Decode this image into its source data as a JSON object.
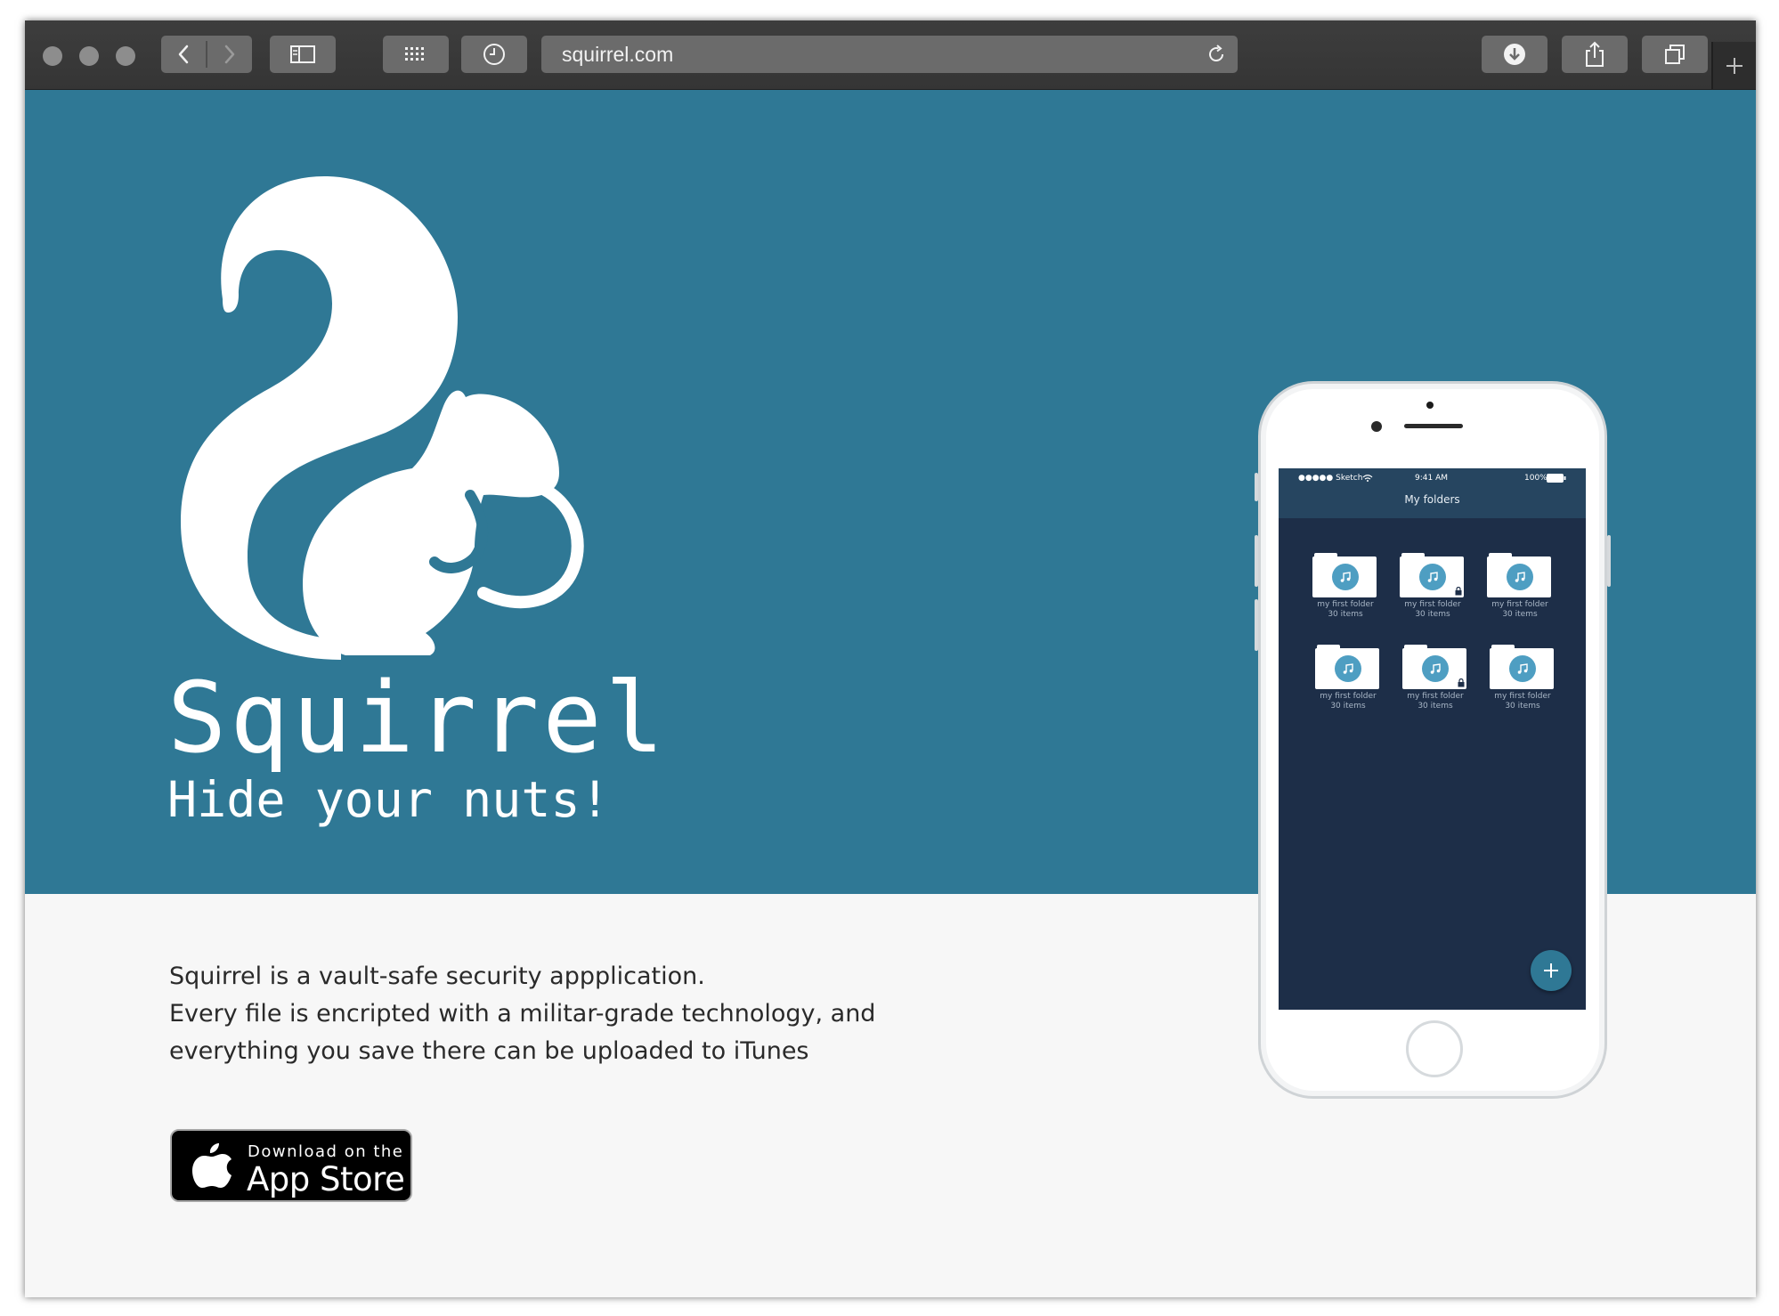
{
  "browser": {
    "url": "squirrel.com",
    "colors": {
      "toolbar": "#3a3a3a",
      "button": "#6b6b6b"
    },
    "icons": [
      "close-dot",
      "minimize-dot",
      "zoom-dot",
      "back-icon",
      "forward-icon",
      "sidebar-icon",
      "grid-icon",
      "history-clock-icon",
      "reload-icon",
      "download-icon",
      "share-icon",
      "tabs-icon",
      "plus-icon"
    ]
  },
  "hero": {
    "app_name": "Squirrel",
    "tagline": "Hide your nuts!",
    "colors": {
      "background": "#2f7895",
      "text": "#ffffff"
    }
  },
  "content": {
    "description_lines": [
      "Squirrel is a vault-safe security appplication.",
      "Every file is encripted with a militar-grade technology, and",
      "everything you save there can be uploaded to iTunes"
    ],
    "app_store_badge": {
      "small_text": "Download on the",
      "big_text": "App Store"
    }
  },
  "phone": {
    "status_bar": {
      "carrier": "●●●●● Sketch",
      "time": "9:41 AM",
      "battery": "100%"
    },
    "screen_title": "My folders",
    "folders": [
      {
        "name": "my first folder",
        "count": "30 items",
        "locked": false
      },
      {
        "name": "my first folder",
        "count": "30 items",
        "locked": true
      },
      {
        "name": "my first folder",
        "count": "30 items",
        "locked": false
      },
      {
        "name": "my first folder",
        "count": "30 items",
        "locked": false
      },
      {
        "name": "my first folder",
        "count": "30 items",
        "locked": true
      },
      {
        "name": "my first folder",
        "count": "30 items",
        "locked": false
      }
    ],
    "colors": {
      "screen": "#1d2e48",
      "navbar": "#264560",
      "accent": "#4e9ec2"
    }
  }
}
